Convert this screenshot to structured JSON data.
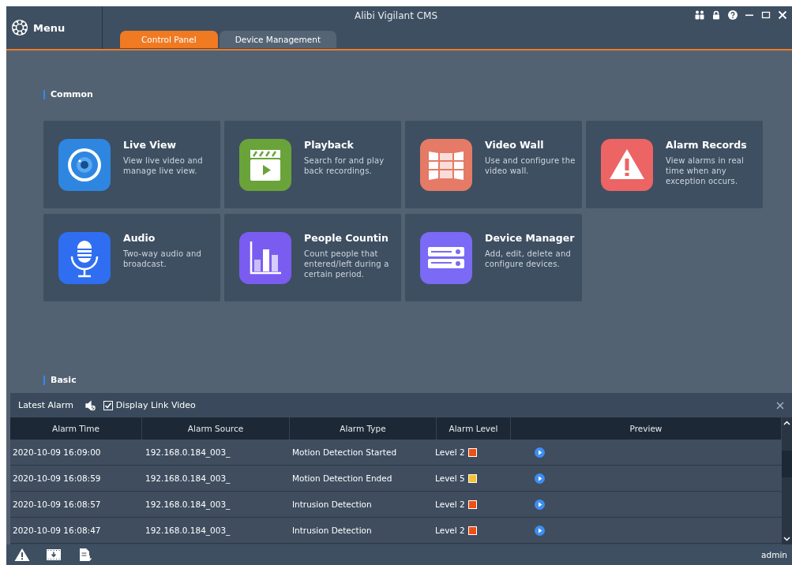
{
  "window": {
    "title": "Alibi Vigilant CMS"
  },
  "menu": {
    "label": "Menu"
  },
  "tabs": [
    {
      "label": "Control Panel",
      "selected": true
    },
    {
      "label": "Device Management",
      "selected": false
    }
  ],
  "sections": [
    {
      "title": "Common",
      "cards": [
        {
          "kind": "live",
          "title": "Live View",
          "description": "View live video and manage live view."
        },
        {
          "kind": "playback",
          "title": "Playback",
          "description": "Search for and play back recordings."
        },
        {
          "kind": "wall",
          "title": "Video Wall",
          "description": "Use and configure the video wall."
        },
        {
          "kind": "alarm",
          "title": "Alarm Records",
          "description": "View alarms in real time when any exception occurs."
        },
        {
          "kind": "audio",
          "title": "Audio",
          "description": "Two-way audio and broadcast."
        },
        {
          "kind": "counting",
          "title": "People Countin",
          "description": "Count people that entered/left during a certain period."
        },
        {
          "kind": "device",
          "title": "Device Manager",
          "description": "Add, edit, delete and configure devices."
        }
      ]
    },
    {
      "title": "Basic"
    }
  ],
  "alarm_panel": {
    "title": "Latest Alarm",
    "display_link_video": {
      "label": "Display Link Video",
      "checked": true
    },
    "columns": [
      "Alarm Time",
      "Alarm Source",
      "Alarm Type",
      "Alarm Level",
      "Preview"
    ],
    "rows": [
      {
        "time": "2020-10-09 16:09:00",
        "source": "192.168.0.184_003_",
        "type": "Motion Detection Started",
        "level": "Level 2",
        "color": "#f24e12"
      },
      {
        "time": "2020-10-09 16:08:59",
        "source": "192.168.0.184_003_",
        "type": "Motion Detection Ended",
        "level": "Level 5",
        "color": "#f5c12e"
      },
      {
        "time": "2020-10-09 16:08:57",
        "source": "192.168.0.184_003_",
        "type": "Intrusion Detection",
        "level": "Level 2",
        "color": "#f24e12"
      },
      {
        "time": "2020-10-09 16:08:47",
        "source": "192.168.0.184_003_",
        "type": "Intrusion Detection",
        "level": "Level 2",
        "color": "#f24e12"
      }
    ]
  },
  "status_bar": {
    "user": "admin"
  }
}
